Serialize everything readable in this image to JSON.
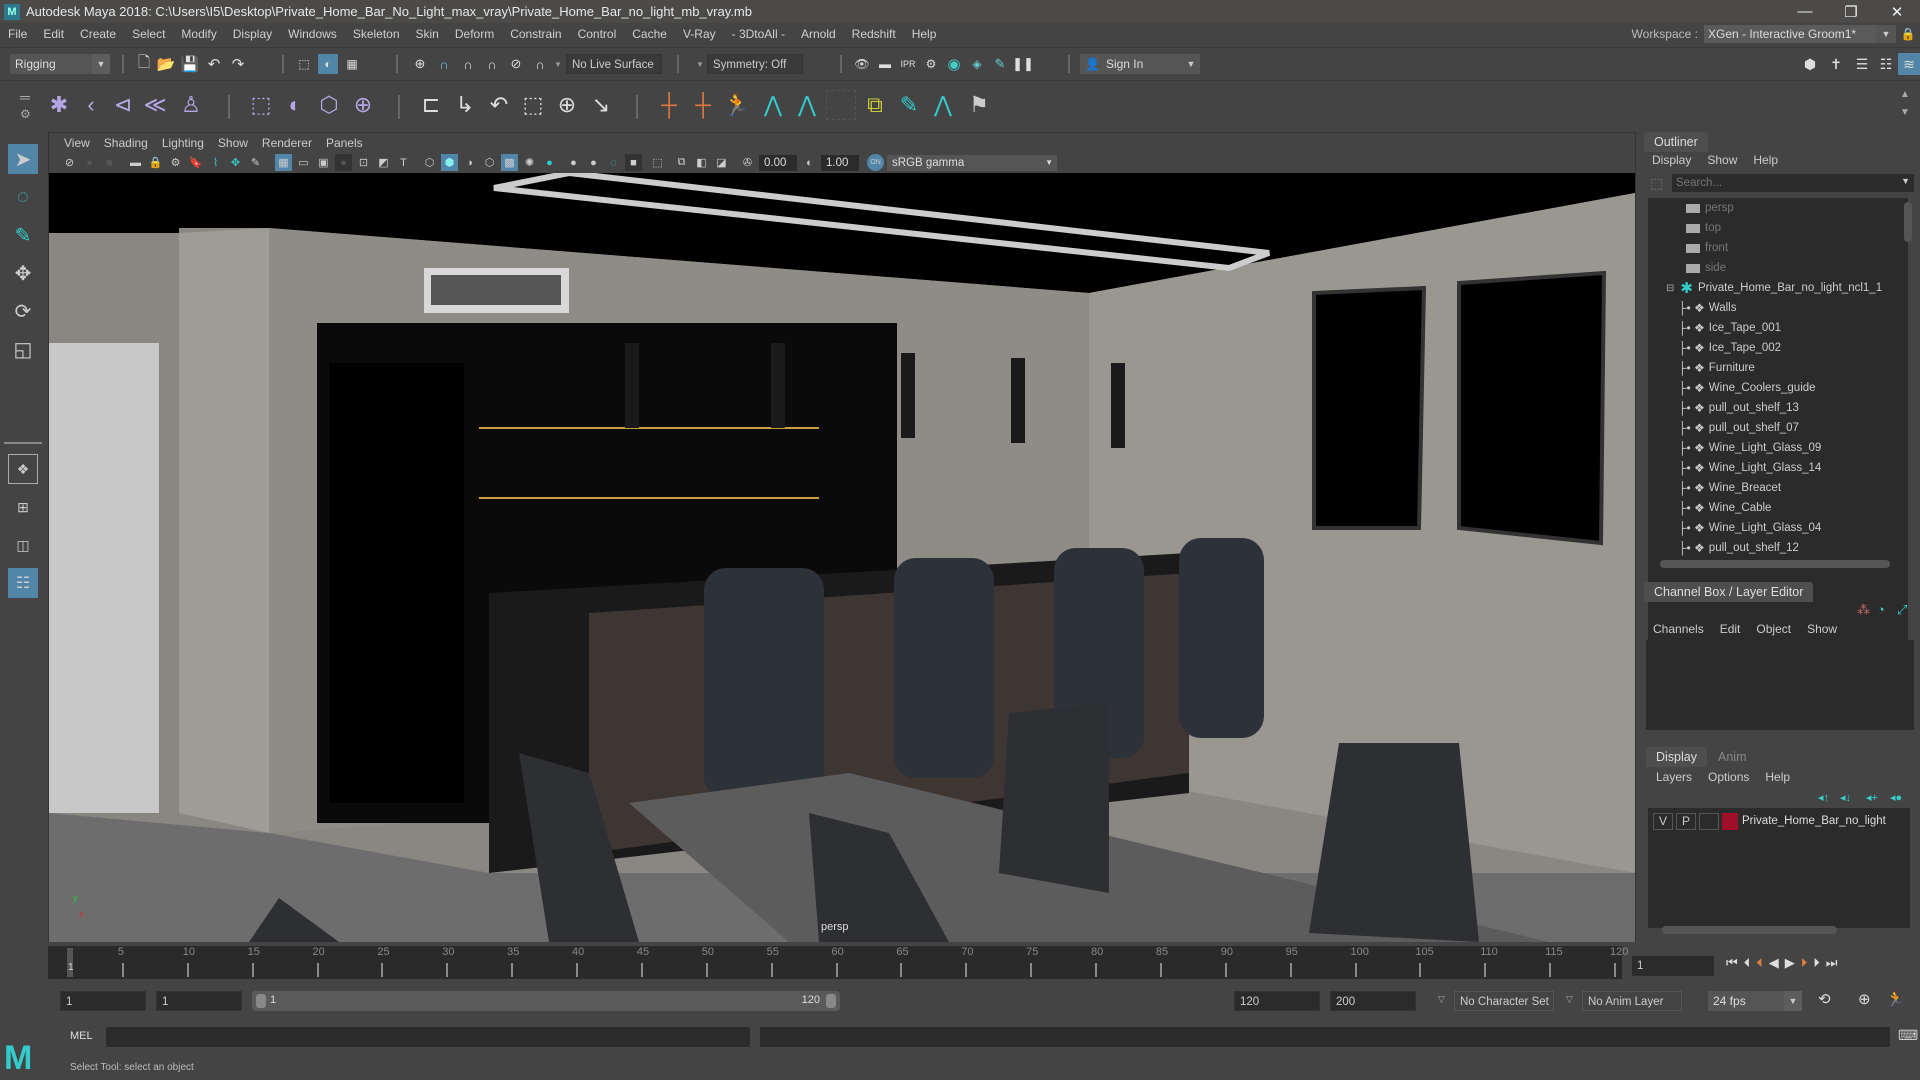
{
  "window": {
    "app_icon": "maya-logo-icon",
    "title": "Autodesk Maya 2018: C:\\Users\\I5\\Desktop\\Private_Home_Bar_No_Light_max_vray\\Private_Home_Bar_no_light_mb_vray.mb",
    "controls": {
      "minimize": "—",
      "restore": "❐",
      "close": "✕"
    }
  },
  "menubar": {
    "items": [
      "File",
      "Edit",
      "Create",
      "Select",
      "Modify",
      "Display",
      "Windows",
      "Skeleton",
      "Skin",
      "Deform",
      "Constrain",
      "Control",
      "Cache",
      "V-Ray",
      "- 3DtoAll -",
      "Arnold",
      "Redshift",
      "Help"
    ],
    "workspace_label": "Workspace :",
    "workspace_value": "XGen - Interactive Groom1*"
  },
  "statusline": {
    "menuset": "Rigging",
    "live_surface": "No Live Surface",
    "symmetry": "Symmetry: Off",
    "sign_in": "Sign In"
  },
  "viewport": {
    "menu": [
      "View",
      "Shading",
      "Lighting",
      "Show",
      "Renderer",
      "Panels"
    ],
    "exposure": "0.00",
    "gamma": "1.00",
    "color_space": "sRGB gamma",
    "camera_label": "persp",
    "axis_labels": {
      "y": "y",
      "x": "x"
    }
  },
  "outliner": {
    "title": "Outliner",
    "menu": [
      "Display",
      "Show",
      "Help"
    ],
    "search_placeholder": "Search...",
    "cameras": [
      "persp",
      "top",
      "front",
      "side"
    ],
    "root": "Private_Home_Bar_no_light_ncl1_1",
    "children": [
      "Walls",
      "Ice_Tape_001",
      "Ice_Tape_002",
      "Furniture",
      "Wine_Coolers_guide",
      "pull_out_shelf_13",
      "pull_out_shelf_07",
      "Wine_Light_Glass_09",
      "Wine_Light_Glass_14",
      "Wine_Breacet",
      "Wine_Cable",
      "Wine_Light_Glass_04",
      "pull_out_shelf_12"
    ]
  },
  "channelbox": {
    "title": "Channel Box / Layer Editor",
    "menu": [
      "Channels",
      "Edit",
      "Object",
      "Show"
    ]
  },
  "layereditor": {
    "tabs": [
      "Display",
      "Anim"
    ],
    "menu": [
      "Layers",
      "Options",
      "Help"
    ],
    "layers": [
      {
        "v": "V",
        "p": "P",
        "name": "Private_Home_Bar_no_light",
        "color": "#a0102a"
      }
    ]
  },
  "timeline": {
    "ticks": [
      "5",
      "10",
      "15",
      "20",
      "25",
      "30",
      "35",
      "40",
      "45",
      "50",
      "55",
      "60",
      "65",
      "70",
      "75",
      "80",
      "85",
      "90",
      "95",
      "100",
      "105",
      "110",
      "115",
      "120"
    ],
    "current_marker": "1",
    "current_frame": "1"
  },
  "range": {
    "start": "1",
    "anim_start": "1",
    "slider_min": "1",
    "slider_max": "120",
    "anim_end": "120",
    "end": "200",
    "character_set": "No Character Set",
    "anim_layer": "No Anim Layer",
    "fps": "24 fps"
  },
  "cmdline": {
    "label": "MEL"
  },
  "helpline": {
    "text": "Select Tool: select an object"
  }
}
